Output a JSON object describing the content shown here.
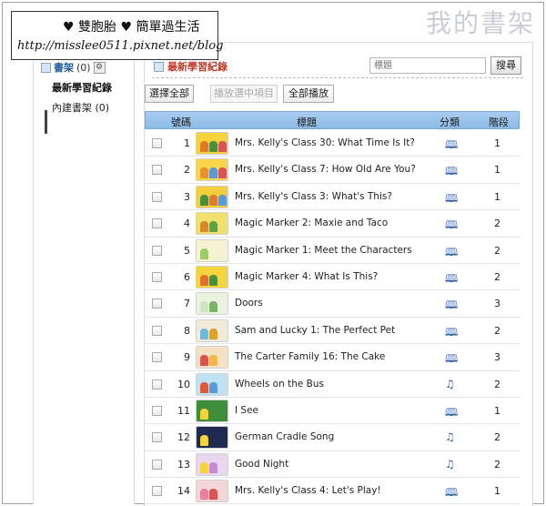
{
  "watermark_title": "我的書架",
  "blog_box": {
    "line1": "♥ 雙胞胎 ♥ 簡單過生活",
    "line2": "http://misslee0511.pixnet.net/blog"
  },
  "sidebar": {
    "title": "書架",
    "count": "(0)",
    "items": [
      {
        "label": "最新學習紀錄",
        "active": true
      },
      {
        "label": "內建書架 (0)",
        "active": false
      }
    ]
  },
  "main": {
    "title": "最新學習紀錄",
    "search": {
      "placeholder": "標題",
      "button": "搜尋"
    },
    "buttons": {
      "select_all": "選擇全部",
      "play_selected": "播放選中項目",
      "play_all": "全部播放"
    },
    "columns": {
      "number": "號碼",
      "title": "標題",
      "category": "分類",
      "stage": "階段"
    },
    "rows": [
      {
        "num": "1",
        "title": "Mrs. Kelly's Class 30: What Time Is It?",
        "category_icon": "book-icon",
        "stage": "1"
      },
      {
        "num": "2",
        "title": "Mrs. Kelly's Class 7: How Old Are You?",
        "category_icon": "book-icon",
        "stage": "1"
      },
      {
        "num": "3",
        "title": "Mrs. Kelly's Class 3: What's This?",
        "category_icon": "book-icon",
        "stage": "1"
      },
      {
        "num": "4",
        "title": "Magic Marker 2: Maxie and Taco",
        "category_icon": "book-icon",
        "stage": "2"
      },
      {
        "num": "5",
        "title": "Magic Marker 1: Meet the Characters",
        "category_icon": "book-icon",
        "stage": "2"
      },
      {
        "num": "6",
        "title": "Magic Marker 4: What Is This?",
        "category_icon": "book-icon",
        "stage": "2"
      },
      {
        "num": "7",
        "title": "Doors",
        "category_icon": "book-icon",
        "stage": "3"
      },
      {
        "num": "8",
        "title": "Sam and Lucky 1: The Perfect Pet",
        "category_icon": "book-icon",
        "stage": "2"
      },
      {
        "num": "9",
        "title": "The Carter Family 16: The Cake",
        "category_icon": "book-icon",
        "stage": "3"
      },
      {
        "num": "10",
        "title": "Wheels on the Bus",
        "category_icon": "music-note-icon",
        "stage": "2"
      },
      {
        "num": "11",
        "title": "I See",
        "category_icon": "book-icon",
        "stage": "1"
      },
      {
        "num": "12",
        "title": "German Cradle Song",
        "category_icon": "music-note-icon",
        "stage": "2"
      },
      {
        "num": "13",
        "title": "Good Night",
        "category_icon": "music-note-icon",
        "stage": "2"
      },
      {
        "num": "14",
        "title": "Mrs. Kelly's Class 4: Let's Play!",
        "category_icon": "book-icon",
        "stage": "1"
      }
    ]
  },
  "colors": {
    "header_blue": "#8dbbe6",
    "sidebar_title": "#1f5e9a",
    "main_title": "#c0392b",
    "icon_blue": "#2f5ea8"
  }
}
